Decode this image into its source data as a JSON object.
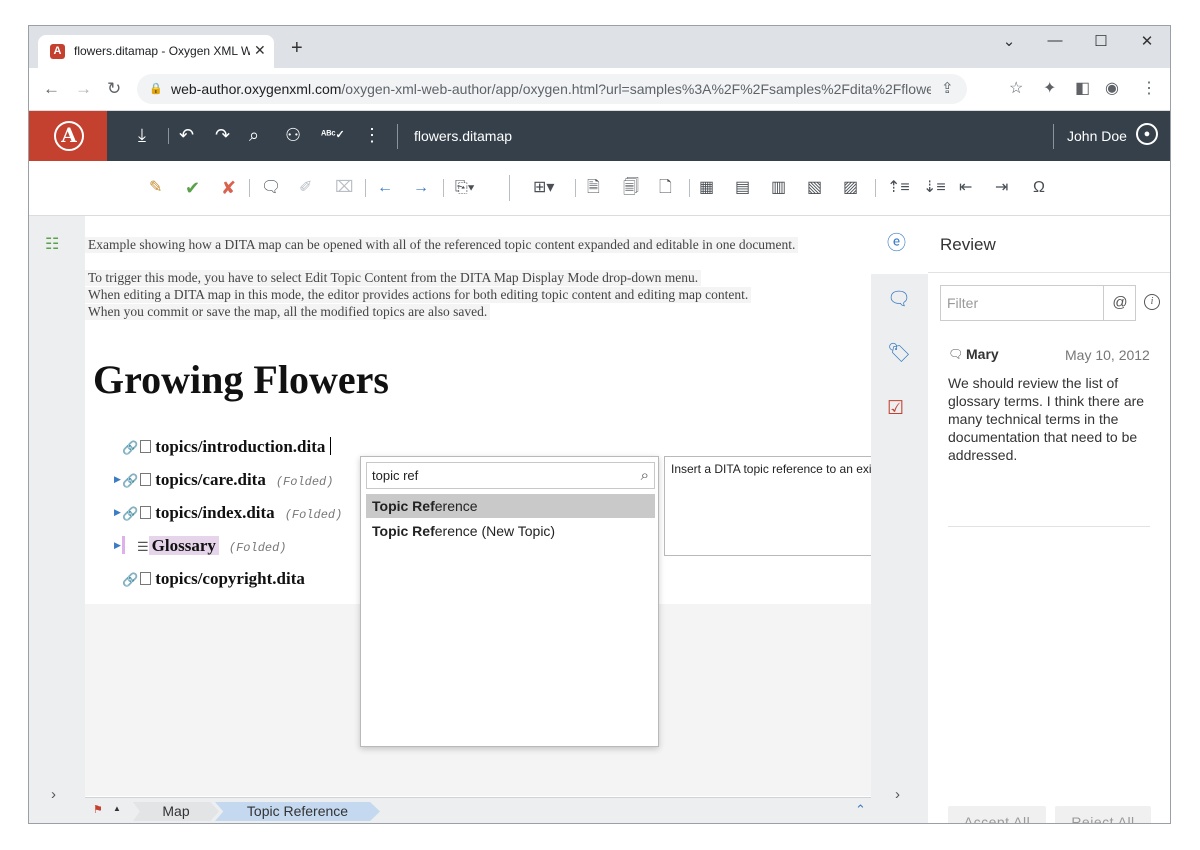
{
  "browser": {
    "tab_title": "flowers.ditamap - Oxygen XML W",
    "favicon_letter": "A",
    "url_domain": "web-author.oxygenxml.com",
    "url_path": "/oxygen-xml-web-author/app/oxygen.html?url=samples%3A%2F%2Fsamples%2Fdita%2Fflowers..."
  },
  "app": {
    "document_title": "flowers.ditamap",
    "user_name": "John Doe"
  },
  "editor": {
    "intro_lines": [
      "Example showing how a DITA map can be opened with all of the referenced topic content expanded and editable in one document.",
      "To trigger this mode, you have to select Edit Topic Content from the DITA Map Display Mode drop-down menu.",
      "When editing a DITA map in this mode, the editor provides actions for both editing topic content and editing map content.",
      "When you commit or save the map, all the modified topics are also saved."
    ],
    "heading": "Growing Flowers",
    "folded_label": "(Folded)",
    "refs": [
      {
        "label": "topics/introduction.dita"
      },
      {
        "label": "topics/care.dita"
      },
      {
        "label": "topics/index.dita"
      },
      {
        "label": "Glossary"
      },
      {
        "label": "topics/copyright.dita"
      }
    ]
  },
  "popup": {
    "search_value": "topic ref",
    "options": [
      {
        "match": "Topic Ref",
        "rest": "erence"
      },
      {
        "match": "Topic Ref",
        "rest": "erence (New Topic)"
      }
    ],
    "tooltip": "Insert a DITA topic reference to an existing resource"
  },
  "statusbar": {
    "crumbs": [
      "Map",
      "Topic Reference"
    ]
  },
  "review": {
    "title": "Review",
    "filter_placeholder": "Filter",
    "at_label": "@",
    "comment": {
      "author": "Mary",
      "date": "May 10, 2012",
      "text": "We should review the list of glossary terms. I think there are many technical terms in the documentation that need to be addressed."
    },
    "accept_all": "Accept All",
    "reject_all": "Reject All"
  },
  "colors": {
    "app_bar": "#36404a",
    "logo_bg": "#c4402f",
    "accent_blue": "#3b7cc4",
    "breadcrumb_active": "#c4d9f0"
  }
}
